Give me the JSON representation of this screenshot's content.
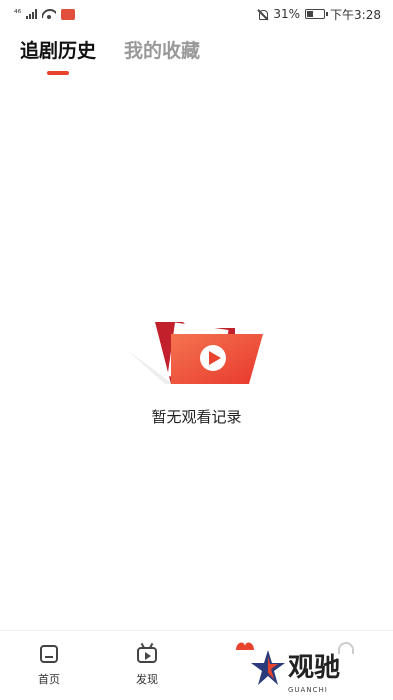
{
  "status_bar": {
    "carrier": "⁴⁶",
    "battery": "31%",
    "battery_level": 0.31,
    "time": "下午3:28"
  },
  "tabs": [
    {
      "label": "追剧历史",
      "active": true
    },
    {
      "label": "我的收藏",
      "active": false
    }
  ],
  "empty_state": {
    "icon": "red-folder-play-icon",
    "message": "暂无观看记录"
  },
  "bottom_nav": [
    {
      "label": "首页",
      "icon": "home-icon"
    },
    {
      "label": "发现",
      "icon": "tv-play-icon"
    }
  ],
  "watermark": {
    "text": "观驰",
    "sub": "GUANCHI"
  },
  "colors": {
    "accent": "#e8442d",
    "inactive_tab": "#999999",
    "folder_dark": "#c2212b",
    "folder_light": "#f06a4a"
  }
}
